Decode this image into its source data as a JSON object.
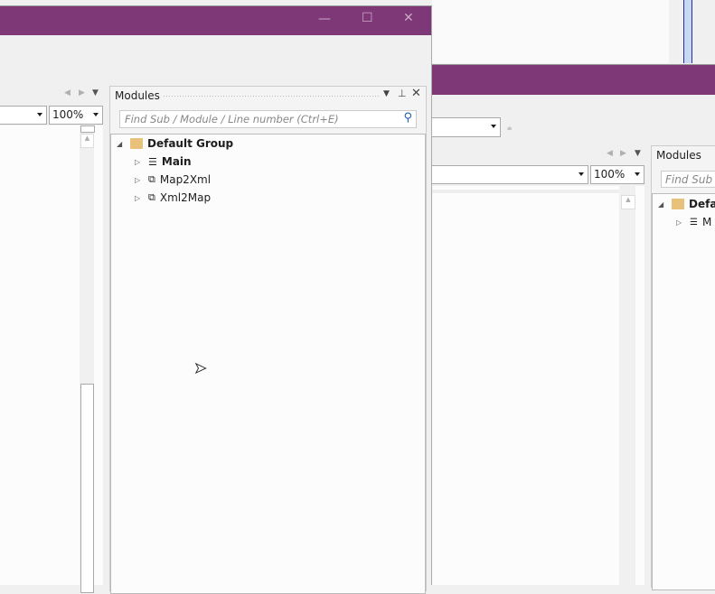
{
  "front_window": {
    "title_controls": {
      "minimize": "—",
      "maximize": "☐",
      "close": "✕"
    },
    "editor": {
      "zoom_value": "100%"
    },
    "modules_pane": {
      "title": "Modules",
      "search_placeholder": "Find Sub / Module / Line number (Ctrl+E)",
      "tree": {
        "group": "Default Group",
        "items": [
          {
            "label": "Main",
            "icon": "procedure-icon",
            "bold": true
          },
          {
            "label": "Map2Xml",
            "icon": "class-module-icon",
            "bold": false
          },
          {
            "label": "Xml2Map",
            "icon": "class-module-icon",
            "bold": false
          }
        ]
      }
    }
  },
  "back_window": {
    "editor": {
      "zoom_value": "100%"
    },
    "modules_pane": {
      "title": "Modules",
      "search_placeholder": "Find Sub / ",
      "tree": {
        "group": "Defa",
        "items": [
          {
            "label": "M"
          }
        ]
      }
    }
  },
  "colors": {
    "title_bar": "#7e3877",
    "folder": "#e8c27a",
    "search_icon": "#1e5fb4"
  }
}
